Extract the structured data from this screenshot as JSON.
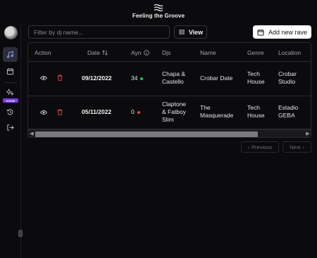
{
  "brand": {
    "title": "Feeling the Groove",
    "logo_icon": "waves-icon"
  },
  "sidebar": {
    "items": [
      {
        "name": "raves",
        "icon": "music-note-icon",
        "active": true
      },
      {
        "name": "calendar",
        "icon": "calendar-icon",
        "active": false
      },
      {
        "name": "soon-feature",
        "icon": "sparkles-icon",
        "badge": "SOON"
      },
      {
        "name": "history",
        "icon": "history-icon",
        "active": false
      },
      {
        "name": "logout",
        "icon": "logout-icon",
        "active": false
      }
    ]
  },
  "toolbar": {
    "filter_placeholder": "Filter by dj name...",
    "filter_value": "",
    "view_label": "View",
    "add_label": "Add new rave"
  },
  "table": {
    "headers": {
      "action": "Action",
      "date": "Date",
      "ayn": "Ayn",
      "djs": "Djs",
      "name": "Name",
      "genre": "Genre",
      "location": "Location"
    },
    "rows": [
      {
        "date": "09/12/2022",
        "ayn": "34",
        "ayn_status_color": "#22c55e",
        "djs": [
          "Chapa &",
          "Castello"
        ],
        "name": "Crobar Date",
        "genre": [
          "Tech",
          "House"
        ],
        "location": [
          "Crobar",
          "Studio"
        ]
      },
      {
        "date": "05/11/2022",
        "ayn": "0",
        "ayn_status_color": "#ef4444",
        "djs": [
          "Claptone",
          "& Fatboy",
          "Slim"
        ],
        "name": [
          "The",
          "Masquerade"
        ],
        "genre": [
          "Tech",
          "House"
        ],
        "location": [
          "Estadio",
          "GEBA"
        ]
      }
    ]
  },
  "pagination": {
    "previous": "Previous",
    "next": "Next"
  },
  "colors": {
    "accent": "#7c3aed",
    "danger": "#ef4444",
    "success": "#22c55e"
  }
}
